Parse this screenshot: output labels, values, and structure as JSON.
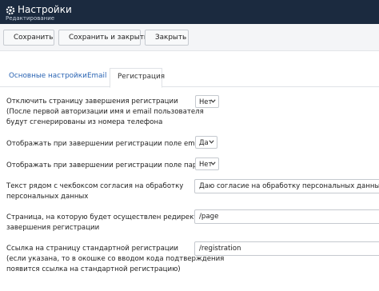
{
  "header": {
    "title": "Настройки",
    "subtitle": "Редактирование"
  },
  "toolbar": {
    "save_label": "Сохранить",
    "save_close_label": "Сохранить и закрыть",
    "close_label": "Закрыть"
  },
  "tabs": [
    {
      "label": "Основные настройки",
      "active": false
    },
    {
      "label": "Email",
      "active": false
    },
    {
      "label": "Регистрация",
      "active": true
    }
  ],
  "fields": [
    {
      "label_lines": [
        "Отключить страницу завершения регистрации",
        "(После первой авторизации имя и email пользователя",
        "будут сгенерированы из номера телефона"
      ],
      "type": "select",
      "value": "Нет"
    },
    {
      "label_lines": [
        "Отображать при завершении регистрации поле email"
      ],
      "type": "select",
      "value": "Да"
    },
    {
      "label_lines": [
        "Отображать при завершении регистрации поле пароль"
      ],
      "type": "select",
      "value": "Нет"
    },
    {
      "label_lines": [
        "Текст рядом с чекбоксом согласия на обработку",
        "персональных данных"
      ],
      "type": "text",
      "value": "Даю согласие на обработку персональных данных"
    },
    {
      "label_lines": [
        "Страница, на которую будет осуществлен редирект после",
        "завершения регистрации"
      ],
      "type": "text",
      "value": "/page"
    },
    {
      "label_lines": [
        "Ссылка на страницу стандартной регистрации",
        "(если указана, то в окошке со вводом кода подтверждения",
        "появится ссылка на стандартной регистрацию)"
      ],
      "type": "text",
      "value": "/registration"
    }
  ],
  "colors": {
    "header_bg": "#1b2a3f",
    "save_icon": "#2e8b3d",
    "close_icon": "#c0392b",
    "tab_link": "#2a64b3"
  }
}
